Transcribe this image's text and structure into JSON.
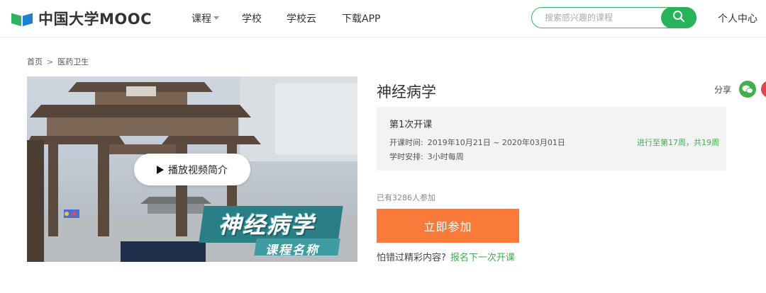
{
  "brand": {
    "name": "中国大学MOOC"
  },
  "nav": {
    "items": [
      {
        "label": "课程",
        "has_caret": true
      },
      {
        "label": "学校"
      },
      {
        "label": "学校云"
      },
      {
        "label": "下载APP"
      }
    ]
  },
  "search": {
    "placeholder": "搜索感兴趣的课程",
    "icon": "search-icon"
  },
  "user_center": "个人中心",
  "breadcrumb": {
    "home": "首页",
    "separator": ">",
    "category": "医药卫生"
  },
  "video": {
    "play_label": "播放视频简介",
    "banner_title": "神经病学",
    "banner_subtitle": "课程名称"
  },
  "course": {
    "title": "神经病学",
    "share_label": "分享",
    "session": "第1次开课",
    "start_label": "开课时间:",
    "start_value": "2019年10月21日 ~ 2020年03月01日",
    "schedule_label": "学时安排:",
    "schedule_value": "3小时每周",
    "progress": "进行至第17周，共19周",
    "enrolled": "已有3286人参加",
    "join_label": "立即参加",
    "missed_text": "怕错过精彩内容?",
    "next_session_link": "报名下一次开课"
  },
  "colors": {
    "brand_green": "#27b35a",
    "join_orange": "#fa7a3a",
    "progress_green": "#3fae50",
    "banner_teal": "#2a7f86"
  }
}
